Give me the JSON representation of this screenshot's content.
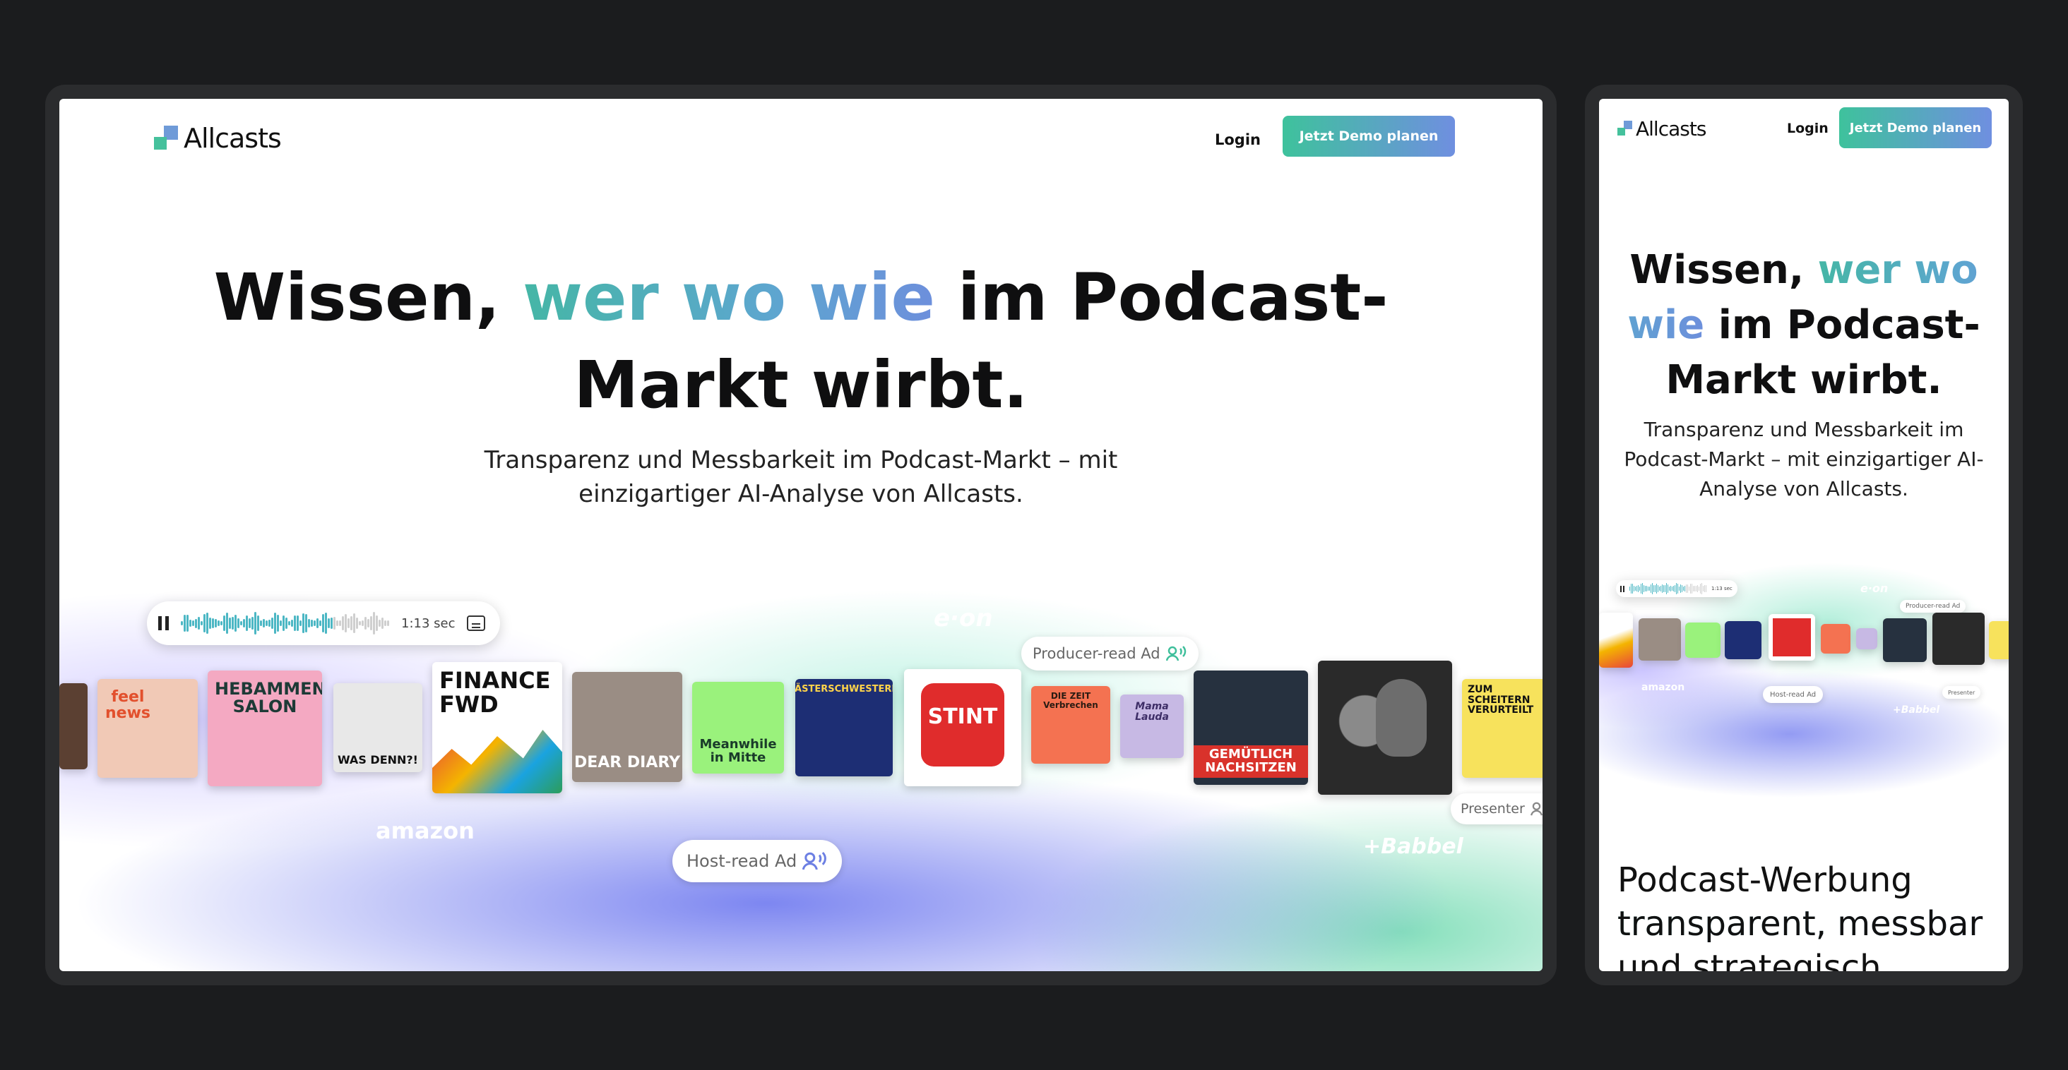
{
  "brand": {
    "name": "Allcasts",
    "accent_teal": "#45c19c",
    "accent_blue": "#6f9bd8"
  },
  "nav": {
    "login_label": "Login",
    "cta_label": "Jetzt Demo planen"
  },
  "hero": {
    "title_start": "Wissen,",
    "title_accent": "wer wo wie",
    "title_end": "im Podcast-Markt wirbt.",
    "subtitle": "Transparenz und Messbarkeit im Podcast-Markt – mit einzigartiger AI-Analyse von Allcasts."
  },
  "player": {
    "time": "1:13 sec",
    "progress": 0.72,
    "icons": [
      "pause-icon",
      "captions-icon"
    ]
  },
  "ad_types": {
    "producer": "Producer-read Ad",
    "host": "Host-read Ad",
    "presenter": "Presenter"
  },
  "advertisers": [
    "amazon",
    "e·on",
    "+Babbel"
  ],
  "covers": [
    {
      "label": "",
      "color": "#5b4032"
    },
    {
      "label": "feel news",
      "color": "#f1c9b6"
    },
    {
      "label": "HEBAMMEN SALON",
      "color": "#f4a9c2"
    },
    {
      "label": "WAS DENN?!",
      "color": "#e8e8e8"
    },
    {
      "label": "FINANCE FWD",
      "color": "#ffffff"
    },
    {
      "label": "DEAR DIARY",
      "color": "#9a8d84"
    },
    {
      "label": "Meanwhile in Mitte",
      "color": "#9af27c"
    },
    {
      "label": "LÄSTERSCHWESTERN",
      "color": "#1d2e74"
    },
    {
      "label": "STINT",
      "color": "#e02c2c"
    },
    {
      "label": "DIE ZEIT Verbrechen",
      "color": "#f47251"
    },
    {
      "label": "Mama Lauda",
      "color": "#c7b9e4"
    },
    {
      "label": "GEMÜTLICH NACHSITZEN",
      "color": "#26313f"
    },
    {
      "label": "",
      "color": "#2a2a2a"
    },
    {
      "label": "ZUM SCHEITERN VERURTEILT",
      "color": "#f7e25c"
    }
  ],
  "mobile": {
    "section_title_1": "Podcast-Werbung",
    "section_title_2": "transparent, messbar",
    "section_title_3": "und strategisch"
  }
}
